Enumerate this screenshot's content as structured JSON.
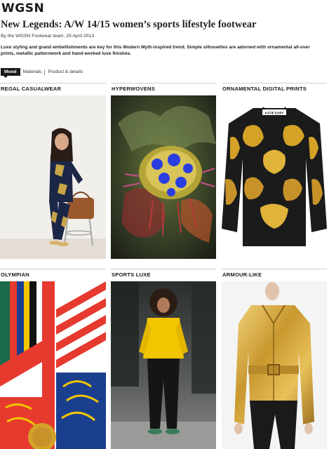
{
  "brand": {
    "logo": "WGSN"
  },
  "article": {
    "title": "New Legends: A/W 14/15 women’s sports lifestyle footwear",
    "byline": "By the WGSN Footwear team, 25 April 2013",
    "intro": "Luxe styling and grand embellishments are key for this Modern Myth-inspired trend. Simple silhouettes are adorned with ornamental all-over prints, metallic patternwork and hand-worked luxe finishes."
  },
  "tabs": [
    {
      "label": "Mood",
      "active": true
    },
    {
      "label": "Materials",
      "active": false
    },
    {
      "label": "Product & details",
      "active": false
    }
  ],
  "cards": [
    {
      "title": "REGAL CASUALWEAR",
      "image": "model-seated-printed-suit"
    },
    {
      "title": "HYPERWOVENS",
      "image": "colourful-woven-textile-art"
    },
    {
      "title": "ORNAMENTAL DIGITAL PRINTS",
      "image": "baroque-print-sweatshirt"
    },
    {
      "title": "OLYMPIAN",
      "image": "striped-graphic-print"
    },
    {
      "title": "SPORTS LUXE",
      "image": "model-yellow-jacket-street"
    },
    {
      "title": "ARMOUR-LIKE",
      "image": "gold-metallic-jacket"
    }
  ],
  "colors": {
    "gold": "#d4a227",
    "accent_yellow": "#f2c500",
    "dark": "#1a1a1a"
  },
  "embedded_text": {
    "sweatshirt_label": "KATIE EARY"
  }
}
